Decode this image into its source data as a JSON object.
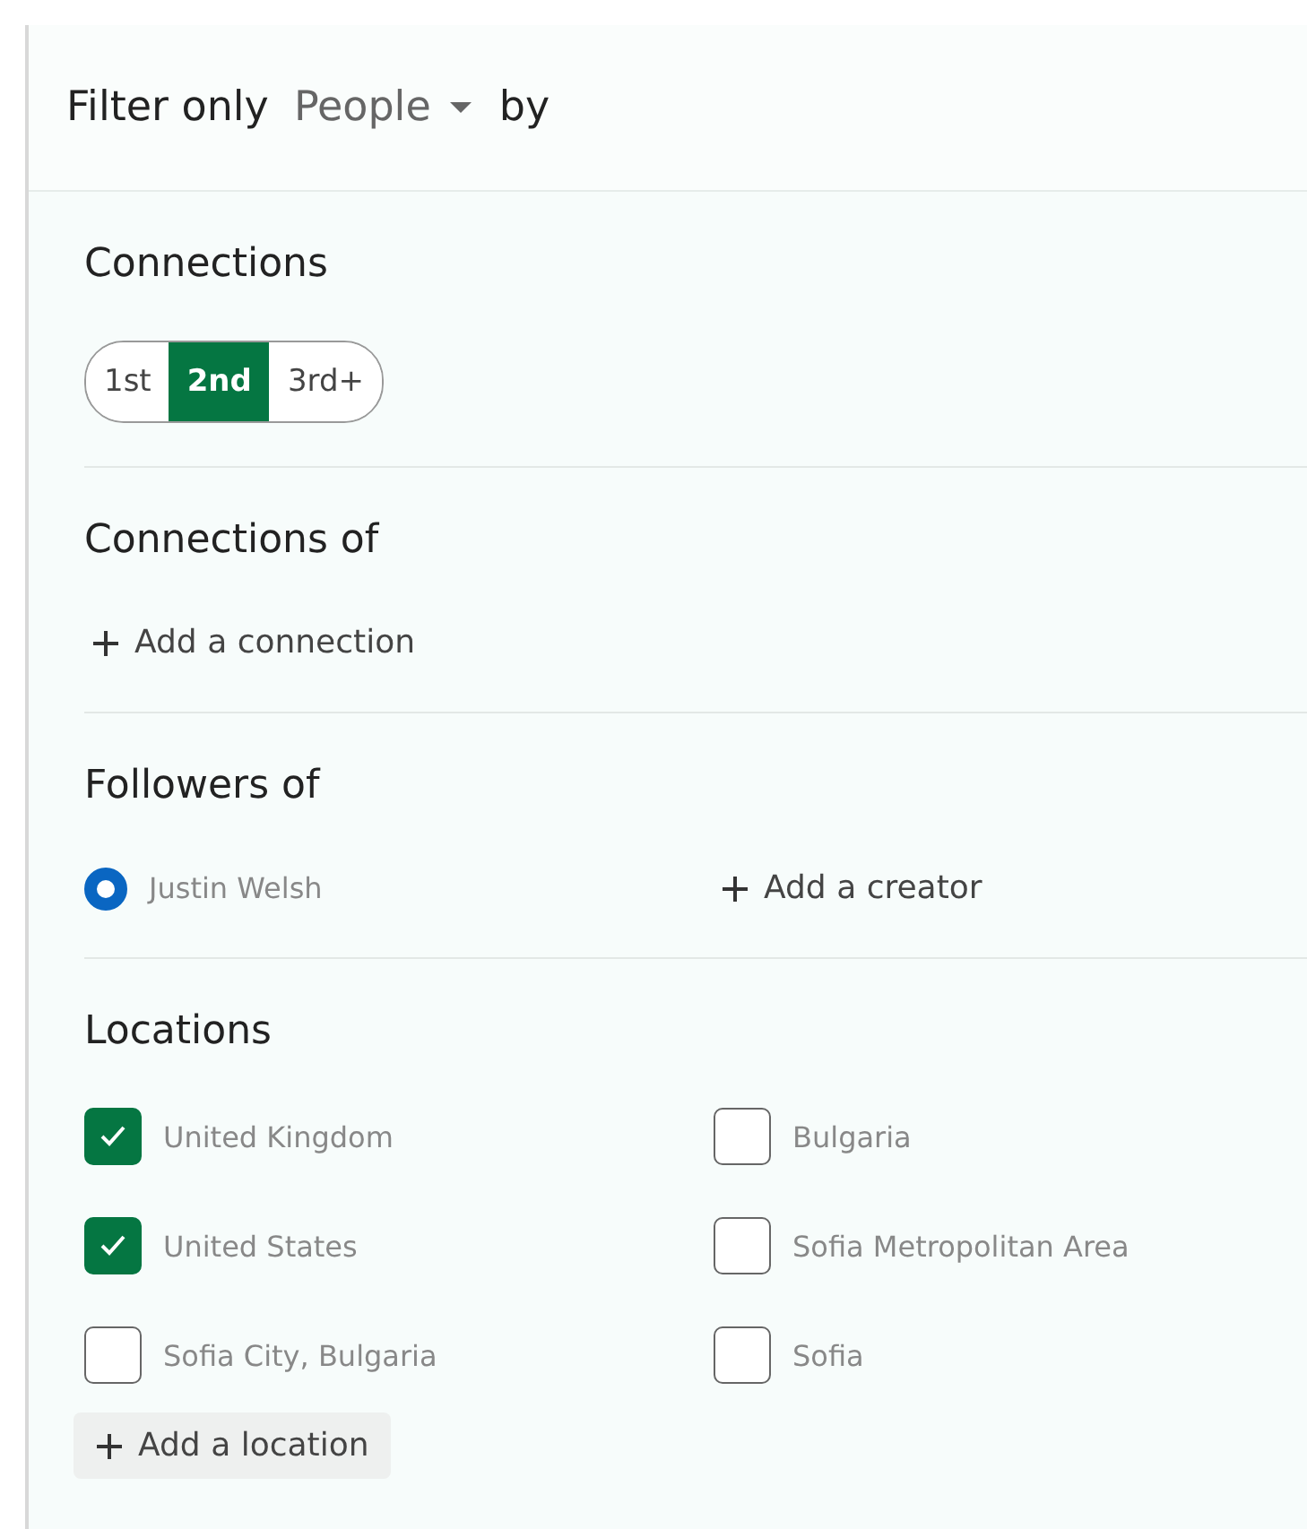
{
  "header": {
    "prefix": "Filter only",
    "dropdown": "People",
    "suffix": "by"
  },
  "connections": {
    "title": "Connections",
    "options": [
      {
        "label": "1st",
        "selected": false
      },
      {
        "label": "2nd",
        "selected": true
      },
      {
        "label": "3rd+",
        "selected": false
      }
    ]
  },
  "connections_of": {
    "title": "Connections of",
    "add": "Add a connection"
  },
  "followers_of": {
    "title": "Followers of",
    "items": [
      {
        "label": "Justin Welsh",
        "selected": true
      }
    ],
    "add": "Add a creator"
  },
  "locations": {
    "title": "Locations",
    "items": [
      {
        "label": "United Kingdom",
        "checked": true
      },
      {
        "label": "Bulgaria",
        "checked": false
      },
      {
        "label": "United States",
        "checked": true
      },
      {
        "label": "Sofia Metropolitan Area",
        "checked": false
      },
      {
        "label": "Sofia City, Bulgaria",
        "checked": false
      },
      {
        "label": "Sofia",
        "checked": false
      }
    ],
    "add": "Add a location"
  }
}
